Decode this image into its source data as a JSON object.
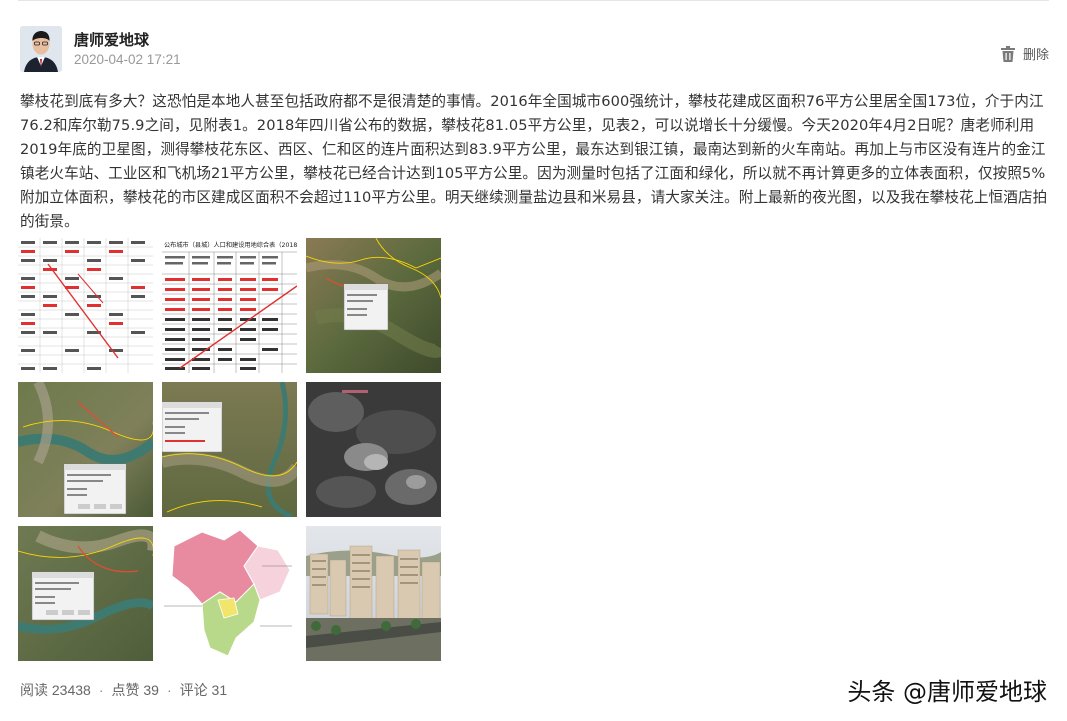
{
  "post": {
    "author": "唐师爱地球",
    "timestamp": "2020-04-02 17:21",
    "delete_label": "删除",
    "text": "攀枝花到底有多大？这恐怕是本地人甚至包括政府都不是很清楚的事情。2016年全国城市600强统计，攀枝花建成区面积76平方公里居全国173位，介于内江76.2和库尔勒75.9之间，见附表1。2018年四川省公布的数据，攀枝花81.05平方公里，见表2，可以说增长十分缓慢。今天2020年4月2日呢？唐老师利用2019年底的卫星图，测得攀枝花东区、西区、仁和区的连片面积达到83.9平方公里，最东达到银江镇，最南达到新的火车南站。再加上与市区没有连片的金江镇老火车站、工业区和飞机场21平方公里，攀枝花已经合计达到105平方公里。因为测量时包括了江面和绿化，所以就不再计算更多的立体表面积，仅按照5%附加立体面积，攀枝花的市区建成区面积不会超过110平方公里。明天继续测量盐边县和米易县，请大家关注。附上最新的夜光图，以及我在攀枝花上恒酒店拍的街景。"
  },
  "images": [
    {
      "name": "city-ranking-table-image",
      "kind": "table1"
    },
    {
      "name": "sichuan-stats-table-image",
      "kind": "table2",
      "caption": "公布城市（县城）人口和建设用地综合表（2018"
    },
    {
      "name": "satellite-map-image-1",
      "kind": "sat1"
    },
    {
      "name": "satellite-map-image-2",
      "kind": "sat2"
    },
    {
      "name": "satellite-map-image-3",
      "kind": "sat3"
    },
    {
      "name": "night-light-image",
      "kind": "night"
    },
    {
      "name": "satellite-map-image-4",
      "kind": "sat4"
    },
    {
      "name": "district-map-image",
      "kind": "distmap"
    },
    {
      "name": "street-view-photo",
      "kind": "street"
    }
  ],
  "footer": {
    "reads": "阅读 23438",
    "likes": "点赞 39",
    "comments": "评论 31",
    "separator": "·"
  },
  "watermark": "头条 @唐师爱地球",
  "colors": {
    "text": "#333333",
    "muted": "#999999",
    "table_red": "#e03030",
    "district_pink": "#e88aa0",
    "district_green": "#b8d98a"
  }
}
